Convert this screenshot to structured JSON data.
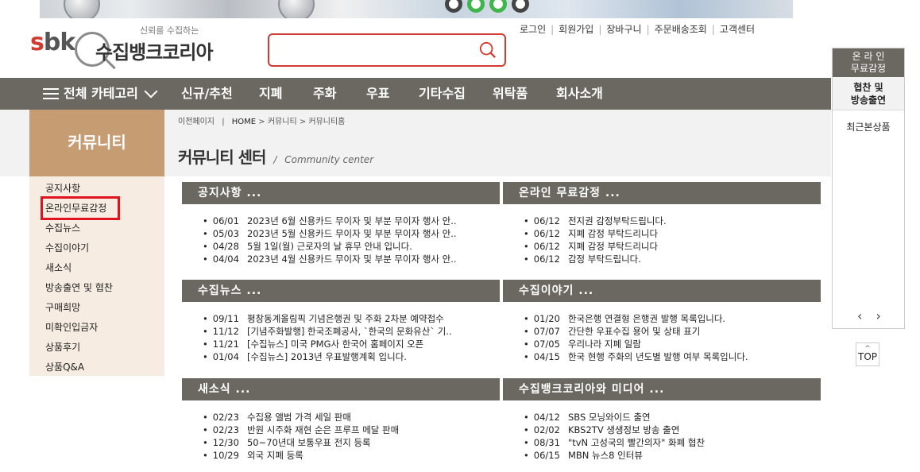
{
  "header": {
    "logo_mark": "sbk",
    "tagline": "신뢰를 수집하는",
    "site_name": "수집뱅크코리아",
    "search_value": ""
  },
  "utility": [
    "로그인",
    "회원가입",
    "장바구니",
    "주문배송조회",
    "고객센터"
  ],
  "nav": {
    "all_label": "전체 카테고리",
    "items": [
      "신규/추천",
      "지폐",
      "주화",
      "우표",
      "기타수집",
      "위탁품",
      "회사소개"
    ]
  },
  "sidebar": {
    "title": "커뮤니티",
    "items": [
      "공지사항",
      "온라인무료감정",
      "수집뉴스",
      "수집이야기",
      "새소식",
      "방송출연 및 협찬",
      "구매희망",
      "미확인입금자",
      "상품후기",
      "상품Q&A"
    ]
  },
  "breadcrumb": {
    "prev": "이전페이지",
    "sep": "|",
    "home": "HOME",
    "path": "> 커뮤니티 > 커뮤니티홈"
  },
  "page": {
    "title": "커뮤니티 센터",
    "slash": "/",
    "subtitle": "Community center"
  },
  "boxes": [
    {
      "title": "공지사항 ...",
      "items": [
        {
          "date": "06/01",
          "text": "2023년 6월 신용카드 무이자 및 부분 무이자 행사 안.."
        },
        {
          "date": "05/03",
          "text": "2023년 5월 신용카드 무이자 및 부분 무이자 행사 안.."
        },
        {
          "date": "04/28",
          "text": "5월 1일(월) 근로자의 날 휴무 안내 입니다."
        },
        {
          "date": "04/04",
          "text": "2023년 4월 신용카드 무이자 및 부분 무이자 행사 안.."
        }
      ]
    },
    {
      "title": "온라인 무료감정 ...",
      "items": [
        {
          "date": "06/12",
          "text": "전지권 감정부탁드립니다."
        },
        {
          "date": "06/12",
          "text": "지폐 감정 부탁드리니다"
        },
        {
          "date": "06/12",
          "text": "지폐 감정 부탁드리니다"
        },
        {
          "date": "06/12",
          "text": "감정 부탁드립니다."
        }
      ]
    },
    {
      "title": "수집뉴스 ...",
      "items": [
        {
          "date": "09/11",
          "text": "평창동계올림픽 기념은행권 및 주화 2차분 예약접수"
        },
        {
          "date": "11/12",
          "text": "[기념주화발행] 한국조폐공사, `한국의 문화유산` 기.."
        },
        {
          "date": "11/21",
          "text": "[수집뉴스] 미국 PMG사 한국어 홈페이지 오픈"
        },
        {
          "date": "01/04",
          "text": "[수집뉴스] 2013년 우표발행계획 입니다."
        }
      ]
    },
    {
      "title": "수집이야기 ...",
      "items": [
        {
          "date": "01/20",
          "text": "한국은행 연결형 은행권 발행 목록입니다."
        },
        {
          "date": "07/07",
          "text": "간단한 우표수집 용어 및 상태 표기"
        },
        {
          "date": "07/05",
          "text": "우리나라 지폐 일람"
        },
        {
          "date": "04/15",
          "text": "한국 현행 주화의 년도별 발행 여부 목록입니다."
        }
      ]
    },
    {
      "title": "새소식 ...",
      "items": [
        {
          "date": "02/23",
          "text": "수집용 앨범 가격 세일 판매"
        },
        {
          "date": "02/23",
          "text": "반원 시주화 재현 순은 프루프 메달 판매"
        },
        {
          "date": "12/30",
          "text": "50~70년대 보통우표 전지 등록"
        },
        {
          "date": "10/29",
          "text": "외국 지폐 등록"
        }
      ]
    },
    {
      "title": "수집뱅크코리아와 미디어 ...",
      "items": [
        {
          "date": "04/12",
          "text": "SBS 모닝와이드 출연"
        },
        {
          "date": "02/02",
          "text": "KBS2TV 생생정보 방송 출연"
        },
        {
          "date": "08/31",
          "text": "\"tvN 고성국의 빨간의자\" 화폐 협찬"
        },
        {
          "date": "06/15",
          "text": "MBN 뉴스8 인터뷰"
        }
      ]
    }
  ],
  "right_widget": {
    "appraisal_line1": "온 라 인",
    "appraisal_line2": "무료감정",
    "sponsor_line1": "협찬 및",
    "sponsor_line2": "방송출연",
    "recent": "최근본상품",
    "prev_arrow": "‹",
    "next_arrow": "›"
  },
  "top_button": "TOP",
  "colors": {
    "accent_red": "#d23b2f",
    "nav_gray": "#6b6862",
    "sidebar_brown": "#c69c73",
    "sidebar_bg": "#f6ece1"
  }
}
